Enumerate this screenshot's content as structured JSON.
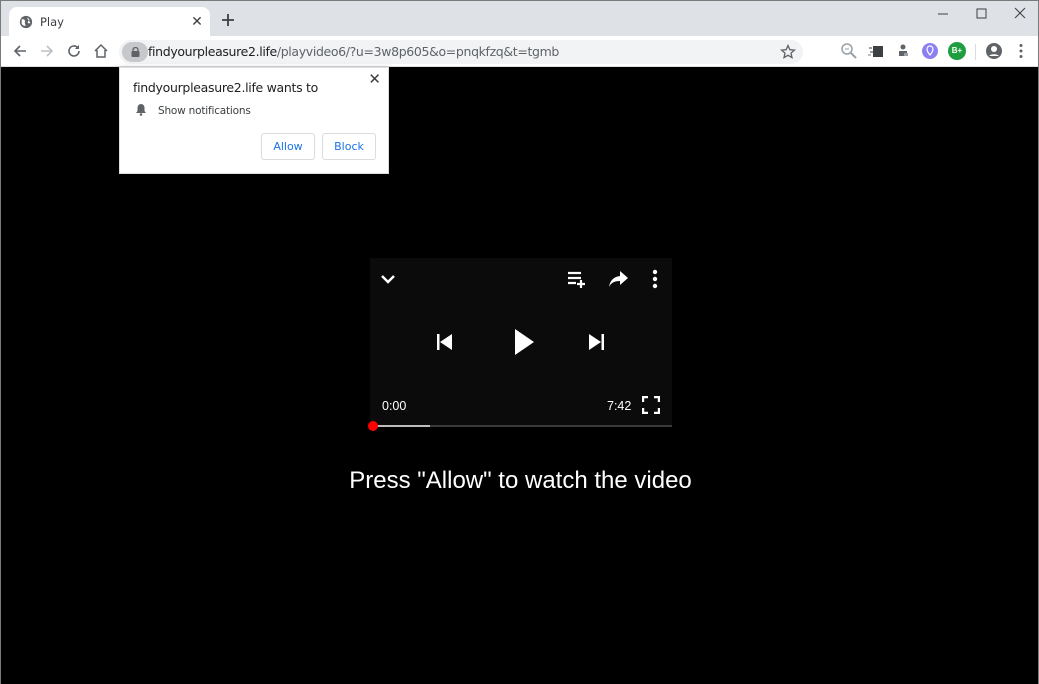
{
  "browser": {
    "tab": {
      "title": "Play",
      "favicon": "globe-icon"
    },
    "new_tab_icon": "plus-icon",
    "window_controls": [
      "minimize-icon",
      "maximize-icon",
      "close-icon"
    ],
    "nav": [
      "back-icon",
      "forward-icon",
      "reload-icon",
      "home-icon"
    ],
    "address": {
      "host": "findyourpleasure2.life",
      "path": "/playvideo6/?u=3w8p605&o=pnqkfzq&t=tgmb",
      "secure_icon": "lock-icon"
    },
    "extensions": [
      "zoom-magnifier-icon",
      "extension-puzzle-icon",
      "extension-stamp-icon",
      "extension-location-icon",
      "extension-b-plus-icon"
    ],
    "extension_badge": "B+",
    "profile_icon": "account-circle-icon",
    "menu_icon": "kebab-menu-icon"
  },
  "permission_popup": {
    "title": "findyourpleasure2.life wants to",
    "permission": "Show notifications",
    "allow_label": "Allow",
    "block_label": "Block"
  },
  "player": {
    "current_time": "0:00",
    "duration": "7:42",
    "progress_fraction": 0.0,
    "buffered_fraction": 0.19,
    "colors": {
      "knob": "#ff0000",
      "buffer": "#bdbdbd",
      "track": "#3a3a3a"
    }
  },
  "cta_text": "Press \"Allow\" to watch the video"
}
